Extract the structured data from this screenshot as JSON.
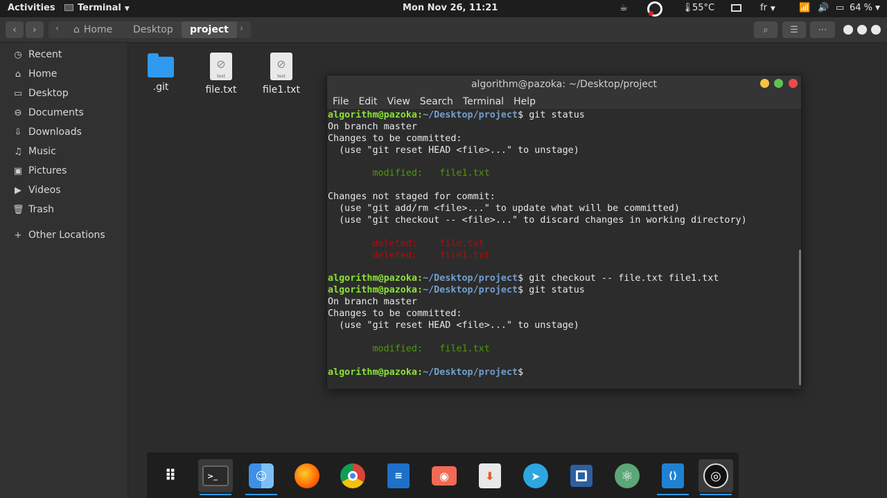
{
  "topbar": {
    "activities": "Activities",
    "app_name": "Terminal",
    "clock": "Mon Nov 26, 11:21",
    "temperature": "55°C",
    "keyboard_layout": "fr",
    "battery": "64 %"
  },
  "fm": {
    "breadcrumbs": [
      "Home",
      "Desktop",
      "project"
    ],
    "sidebar": [
      {
        "label": "Recent",
        "icon": "clock-icon"
      },
      {
        "label": "Home",
        "icon": "home-icon"
      },
      {
        "label": "Desktop",
        "icon": "desktop-icon"
      },
      {
        "label": "Documents",
        "icon": "documents-icon"
      },
      {
        "label": "Downloads",
        "icon": "download-icon"
      },
      {
        "label": "Music",
        "icon": "music-icon"
      },
      {
        "label": "Pictures",
        "icon": "pictures-icon"
      },
      {
        "label": "Videos",
        "icon": "videos-icon"
      },
      {
        "label": "Trash",
        "icon": "trash-icon"
      },
      {
        "label": "Other Locations",
        "icon": "plus-icon"
      }
    ],
    "files": [
      {
        "name": ".git",
        "type": "folder"
      },
      {
        "name": "file.txt",
        "type": "text"
      },
      {
        "name": "file1.txt",
        "type": "text"
      }
    ],
    "file_badge": "text"
  },
  "terminal": {
    "title": "algorithm@pazoka: ~/Desktop/project",
    "menu": [
      "File",
      "Edit",
      "View",
      "Search",
      "Terminal",
      "Help"
    ],
    "prompt_user": "algorithm@pazoka",
    "prompt_path": "~/Desktop/project",
    "lines": {
      "l1_cmd": " git status",
      "l2": "On branch master",
      "l3": "Changes to be committed:",
      "l4": "  (use \"git reset HEAD <file>...\" to unstage)",
      "l6": "        modified:   file1.txt",
      "l8": "Changes not staged for commit:",
      "l9": "  (use \"git add/rm <file>...\" to update what will be committed)",
      "l10": "  (use \"git checkout -- <file>...\" to discard changes in working directory)",
      "l12": "        deleted:    file.txt",
      "l13": "        deleted:    file1.txt",
      "l15_cmd": " git checkout -- file.txt file1.txt",
      "l16_cmd": " git status",
      "l17": "On branch master",
      "l18": "Changes to be committed:",
      "l19": "  (use \"git reset HEAD <file>...\" to unstage)",
      "l21": "        modified:   file1.txt"
    }
  },
  "dock": [
    {
      "name": "app-grid",
      "icon": "grid-icon"
    },
    {
      "name": "terminal",
      "icon": "terminal-icon",
      "running": true
    },
    {
      "name": "files",
      "icon": "finder-icon",
      "running": true
    },
    {
      "name": "firefox",
      "icon": "firefox-icon"
    },
    {
      "name": "chrome",
      "icon": "chrome-icon"
    },
    {
      "name": "writer",
      "icon": "document-writer-icon"
    },
    {
      "name": "screenshot",
      "icon": "camera-icon"
    },
    {
      "name": "installer",
      "icon": "download-box-icon"
    },
    {
      "name": "telegram",
      "icon": "telegram-icon"
    },
    {
      "name": "terminal-emulator",
      "icon": "square-app-icon"
    },
    {
      "name": "atom",
      "icon": "atom-icon"
    },
    {
      "name": "vscode",
      "icon": "vscode-icon",
      "running": true
    },
    {
      "name": "obs",
      "icon": "obs-icon",
      "running": true
    }
  ],
  "colors": {
    "prompt_user": "#8ae234",
    "prompt_path": "#729fcf",
    "git_green": "#4e9a06",
    "git_red": "#cc0000",
    "folder": "#2f9af0"
  }
}
